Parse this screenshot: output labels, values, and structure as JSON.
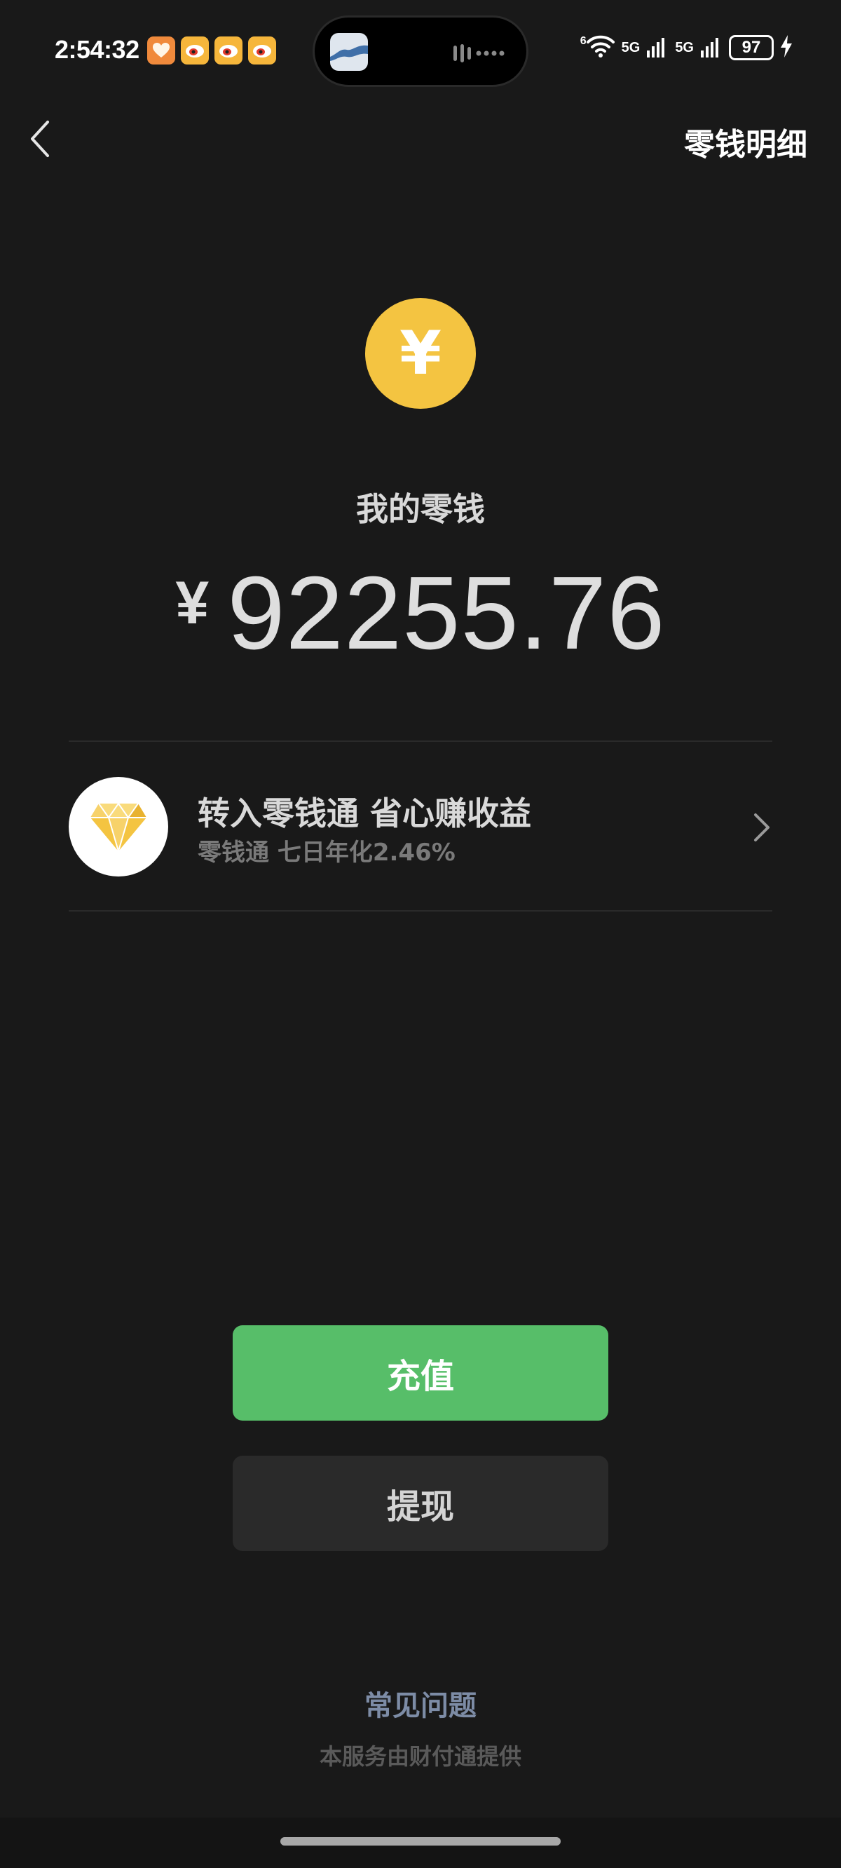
{
  "status_bar": {
    "time": "2:54:32",
    "battery": "97",
    "net_label_1": "5G",
    "net_label_2": "5G",
    "wifi_badge": "6"
  },
  "nav": {
    "title": "零钱明细"
  },
  "wallet": {
    "label": "我的零钱",
    "currency_symbol": "¥",
    "amount": "92255.76",
    "coin_symbol": "¥",
    "coin_color": "#f4c441"
  },
  "promo": {
    "title": "转入零钱通 省心赚收益",
    "subtitle": "零钱通 七日年化2.46%",
    "icon": "diamond-icon"
  },
  "actions": {
    "recharge_label": "充值",
    "withdraw_label": "提现",
    "accent": "#57be69"
  },
  "footer": {
    "faq_label": "常见问题",
    "provider_text": "本服务由财付通提供"
  }
}
